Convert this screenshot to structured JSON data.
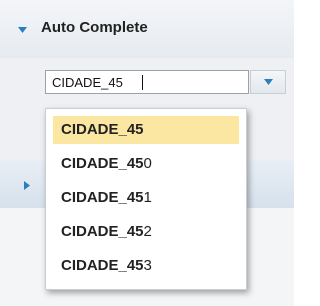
{
  "panel": {
    "title": "Auto Complete",
    "expanded_icon": "triangle-down-icon"
  },
  "autocomplete": {
    "value": "CIDADE_45",
    "toggle_icon": "triangle-down-icon",
    "suggestions": [
      {
        "match": "CIDADE_45",
        "rest": ""
      },
      {
        "match": "CIDADE_45",
        "rest": "0"
      },
      {
        "match": "CIDADE_45",
        "rest": "1"
      },
      {
        "match": "CIDADE_45",
        "rest": "2"
      },
      {
        "match": "CIDADE_45",
        "rest": "3"
      }
    ],
    "highlighted_index": 0
  },
  "panel2": {
    "collapsed_icon": "triangle-right-icon"
  },
  "colors": {
    "accent": "#2a7fc0",
    "highlight": "#fbe7a2"
  }
}
